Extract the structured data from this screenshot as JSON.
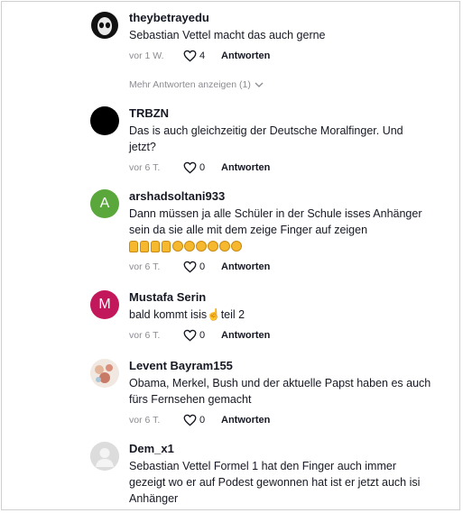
{
  "comments": [
    {
      "user": "theybetrayedu",
      "text": "Sebastian Vettel macht das auch gerne",
      "time": "vor 1 W.",
      "likes": "4",
      "reply": "Antworten"
    },
    {
      "user": "TRBZN",
      "text": "Das is auch gleichzeitig der Deutsche Moralfinger. Und jetzt?",
      "time": "vor 6 T.",
      "likes": "0",
      "reply": "Antworten"
    },
    {
      "user": "arshadsoltani933",
      "avatar_letter": "A",
      "avatar_color": "#5aa83c",
      "text": "Dann müssen ja alle Schüler in der Schule isses Anhänger sein da sie alle mit dem zeige Finger auf zeigen",
      "time": "vor 6 T.",
      "likes": "0",
      "reply": "Antworten"
    },
    {
      "user": "Mustafa Serin",
      "avatar_letter": "M",
      "avatar_color": "#c2185b",
      "text": "bald kommt isis☝teil 2",
      "time": "vor 6 T.",
      "likes": "0",
      "reply": "Antworten"
    },
    {
      "user": "Levent Bayram155",
      "text": "Obama, Merkel, Bush und der aktuelle Papst haben es auch fürs Fernsehen gemacht",
      "time": "vor 6 T.",
      "likes": "0",
      "reply": "Antworten"
    },
    {
      "user": "Dem_x1",
      "text": "Sebastian Vettel Formel 1 hat den Finger auch immer gezeigt wo er auf Podest gewonnen hat ist er jetzt auch isi Anhänger"
    }
  ],
  "more_replies": "Mehr Antworten anzeigen (1)",
  "icons": {
    "like": "heart-icon",
    "more": "chevron-down-icon"
  }
}
